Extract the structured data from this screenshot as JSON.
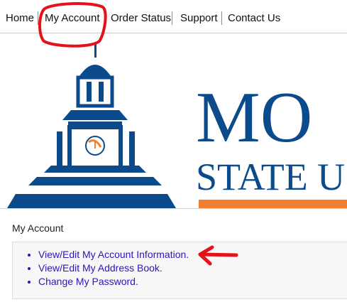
{
  "nav": {
    "items": [
      {
        "label": "Home"
      },
      {
        "label": "My Account"
      },
      {
        "label": "Order Status"
      },
      {
        "label": "Support"
      },
      {
        "label": "Contact Us"
      }
    ]
  },
  "banner": {
    "logo_line1": "MO",
    "logo_line2": "STATE U",
    "colors": {
      "brand_blue": "#0b4a8b",
      "brand_orange": "#f08030"
    }
  },
  "content": {
    "title": "My Account",
    "links": [
      {
        "label": "View/Edit My Account Information."
      },
      {
        "label": "View/Edit My Address Book."
      },
      {
        "label": "Change My Password."
      }
    ]
  },
  "colors": {
    "annotation_red": "#e4121a",
    "link": "#3311bb"
  }
}
